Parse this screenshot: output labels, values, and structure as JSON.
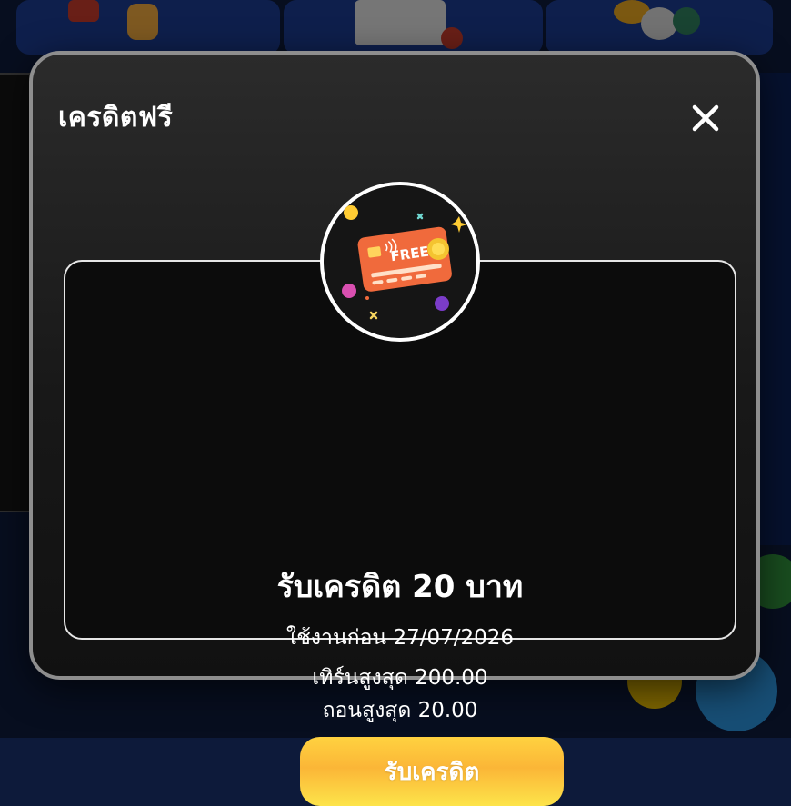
{
  "modal": {
    "title": "เครดิตฟรี",
    "close_icon": "close-icon"
  },
  "promo": {
    "image_label": "FREE",
    "title": "รับเครดิต 20 บาท",
    "expire": "ใช้งานก่อน 27/07/2026",
    "turnover": "เทิร์นสูงสุด 200.00",
    "withdraw": "ถอนสูงสุด 20.00",
    "claim_label": "รับเครดิต"
  },
  "colors": {
    "button_top": "#ffd240",
    "button_bottom": "#fde44a",
    "card_orange": "#f06a3c",
    "modal_border": "#8e8e8e"
  }
}
